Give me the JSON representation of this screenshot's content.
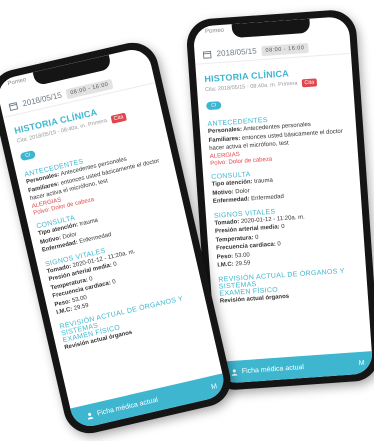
{
  "colors": {
    "accent": "#3fb6cf",
    "alert": "#e0474c"
  },
  "phones": [
    {
      "topline": "Pomeo",
      "date": "2018/05/15",
      "time_pill": "08:00 - 16:00",
      "title": "HISTORIA CLÍNICA",
      "meta_date": "Cita: 2018/05/15 - 08:40a. m.",
      "meta_type": "Primera",
      "badge": "Cita",
      "chip": "CI",
      "antecedentes": {
        "heading": "ANTECEDENTES",
        "personales_label": "Personales:",
        "personales_value": "Antecedentes personales",
        "familiares_label": "Familiares:",
        "familiares_value": "entonces usted básicamente el doctor",
        "continuation": "hacer activa el micrófono, test",
        "alergias_heading": "ALERGIAS",
        "alergia": "Polvo: Dolor de cabeza"
      },
      "consulta": {
        "heading": "CONSULTA",
        "tipo_label": "Tipo atención:",
        "tipo_value": "trauma",
        "motivo_label": "Motivo:",
        "motivo_value": "Dolor",
        "enfermedad_label": "Enfermedad:",
        "enfermedad_value": "Enfermedad"
      },
      "signos": {
        "heading": "SIGNOS VITALES",
        "tomado_label": "Tomado:",
        "tomado_value": "2020-01-12 - 11:20a. m.",
        "presion_label": "Presión arterial media:",
        "presion_value": "0",
        "temp_label": "Temperatura:",
        "temp_value": "0",
        "frec_label": "Frecuencia cardiaca:",
        "frec_value": "0",
        "peso_label": "Peso:",
        "peso_value": "53.00",
        "imc_label": "I.M.C:",
        "imc_value": "29.59"
      },
      "revision": {
        "heading": "REVISIÓN ACTUAL DE ÓRGANOS Y SISTEMAS",
        "examen": "EXAMEN FÍSICO",
        "revision_label": "Revisión actual órganos"
      },
      "bottom_label": "Ficha médica actual",
      "bottom_right": "M"
    },
    {
      "topline": "Pomeo",
      "date": "2018/05/15",
      "time_pill": "08:00 - 16:00",
      "title": "HISTORIA CLÍNICA",
      "meta_date": "Cita: 2018/05/15 - 08:40a. m.",
      "meta_type": "Primera",
      "badge": "Cita",
      "chip": "CI",
      "antecedentes": {
        "heading": "ANTECEDENTES",
        "personales_label": "Personales:",
        "personales_value": "Antecedentes personales",
        "familiares_label": "Familiares:",
        "familiares_value": "entonces usted básicamente el doctor",
        "continuation": "hacer activa el micrófono, test",
        "alergias_heading": "ALERGIAS",
        "alergia": "Polvo: Dolor de cabeza"
      },
      "consulta": {
        "heading": "CONSULTA",
        "tipo_label": "Tipo atención:",
        "tipo_value": "trauma",
        "motivo_label": "Motivo:",
        "motivo_value": "Dolor",
        "enfermedad_label": "Enfermedad:",
        "enfermedad_value": "Enfermedad"
      },
      "signos": {
        "heading": "SIGNOS VITALES",
        "tomado_label": "Tomado:",
        "tomado_value": "2020-01-12 - 11:20a. m.",
        "presion_label": "Presión arterial media:",
        "presion_value": "0",
        "temp_label": "Temperatura:",
        "temp_value": "0",
        "frec_label": "Frecuencia cardiaca:",
        "frec_value": "0",
        "peso_label": "Peso:",
        "peso_value": "53.00",
        "imc_label": "I.M.C:",
        "imc_value": "29.59"
      },
      "revision": {
        "heading": "REVISIÓN ACTUAL DE ÓRGANOS Y SISTEMAS",
        "examen": "EXAMEN FÍSICO",
        "revision_label": "Revisión actual órganos"
      },
      "bottom_label": "Ficha médica actual",
      "bottom_right": "M"
    }
  ]
}
